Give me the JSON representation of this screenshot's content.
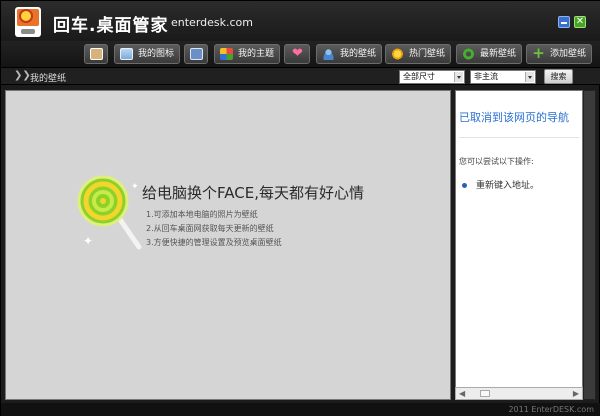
{
  "header": {
    "app_title": "回车.桌面管家",
    "domain": "enterdesk.com",
    "close_glyph": "✕"
  },
  "toolbar": {
    "buttons": [
      {
        "label": "",
        "icon": "notes-icon"
      },
      {
        "label": "我的图标",
        "icon": "icon-grid-icon"
      },
      {
        "label": "",
        "icon": "screenshot-icon"
      },
      {
        "label": "我的主题",
        "icon": "theme-icon"
      },
      {
        "label": "",
        "icon": "heart-icon"
      },
      {
        "label": "我的壁纸",
        "icon": "user-icon"
      },
      {
        "label": "热门壁纸",
        "icon": "hot-icon"
      },
      {
        "label": "最新壁纸",
        "icon": "refresh-icon"
      },
      {
        "label": "添加壁纸",
        "icon": "add-icon"
      }
    ]
  },
  "subbar": {
    "arrow": "❯❯",
    "breadcrumb": "我的壁纸",
    "size_select": "全部尺寸",
    "style_select": "非主流",
    "search_label": "搜索"
  },
  "main": {
    "promo_title": "给电脑换个FACE,每天都有好心情",
    "promo_lines": [
      "1.可添加本地电脑的照片为壁纸",
      "2.从回车桌面网获取每天更新的壁纸",
      "3.方便快捷的管理设置及预览桌面壁纸"
    ]
  },
  "side_panel": {
    "title": "已取消到该网页的导航",
    "tip": "您可以尝试以下操作:",
    "action": "重新键入地址。"
  },
  "status": {
    "copyright": "2011 EnterDESK.com"
  },
  "colors": {
    "accent_blue": "#2a6fd1",
    "lollipop_green": "#8ed12d",
    "lollipop_yellow": "#f4d52b"
  }
}
